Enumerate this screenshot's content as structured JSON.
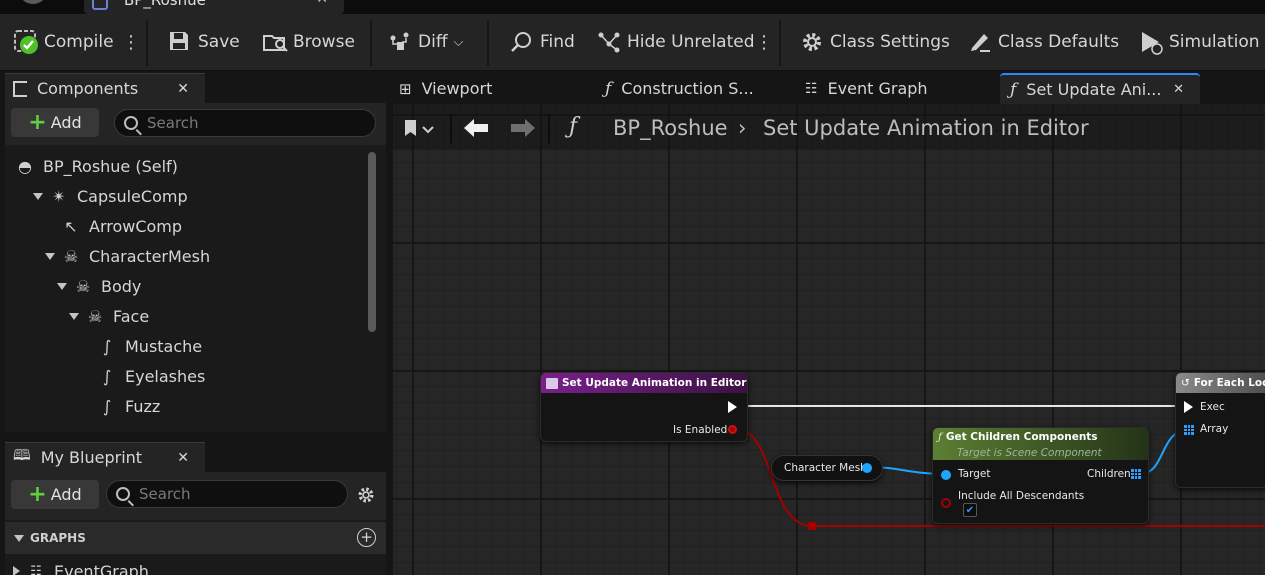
{
  "window": {
    "document_title": "BP_Roshue"
  },
  "toolbar": {
    "compile": "Compile",
    "save": "Save",
    "browse": "Browse",
    "diff": "Diff",
    "find": "Find",
    "hide_unrelated": "Hide Unrelated",
    "class_settings": "Class Settings",
    "class_defaults": "Class Defaults",
    "simulation": "Simulation"
  },
  "components_panel": {
    "title": "Components",
    "add_label": "Add",
    "search_placeholder": "Search",
    "tree": [
      {
        "label": "BP_Roshue (Self)"
      },
      {
        "label": "CapsuleComp"
      },
      {
        "label": "ArrowComp"
      },
      {
        "label": "CharacterMesh"
      },
      {
        "label": "Body"
      },
      {
        "label": "Face"
      },
      {
        "label": "Mustache"
      },
      {
        "label": "Eyelashes"
      },
      {
        "label": "Fuzz"
      }
    ]
  },
  "my_blueprint_panel": {
    "title": "My Blueprint",
    "add_label": "Add",
    "search_placeholder": "Search",
    "section_graphs": "GRAPHS",
    "graphs": [
      {
        "label": "EventGraph"
      }
    ]
  },
  "graph_tabs": [
    {
      "label": "Viewport"
    },
    {
      "label": "Construction S..."
    },
    {
      "label": "Event Graph"
    },
    {
      "label": "Set Update Ani..."
    }
  ],
  "breadcrumb": {
    "root": "BP_Roshue",
    "current": "Set Update Animation in Editor"
  },
  "nodes": {
    "entry": {
      "title": "Set Update Animation in Editor",
      "pin_is_enabled": "Is Enabled"
    },
    "variable": {
      "label": "Character Mesh"
    },
    "get_children": {
      "title": "Get Children Components",
      "subtitle": "Target is Scene Component",
      "pin_target": "Target",
      "pin_children": "Children",
      "pin_include": "Include All Descendants"
    },
    "for_each": {
      "title": "For Each Loop",
      "pin_exec": "Exec",
      "pin_array": "Array"
    }
  },
  "colors": {
    "accent": "#2f86ff",
    "function_header": "#4f6e2c",
    "entry_header": "#6c1c7c",
    "exec_wire": "#e6e6e6",
    "object_pin": "#1ea6ff",
    "bool_pin": "#a50000"
  }
}
